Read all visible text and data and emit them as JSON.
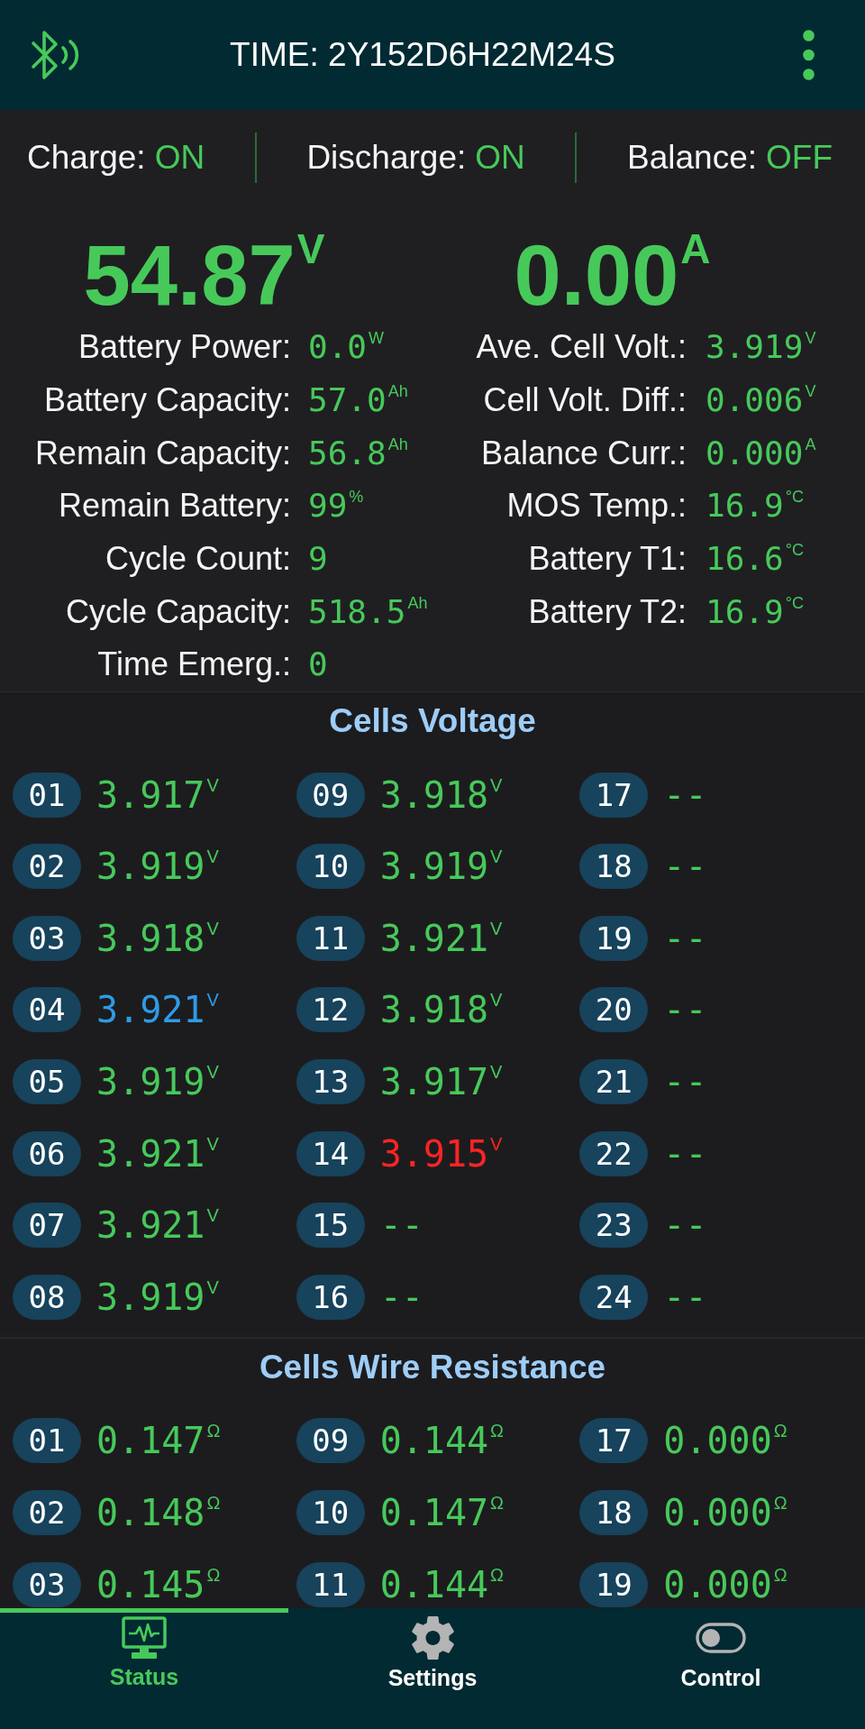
{
  "header": {
    "title": "TIME: 2Y152D6H22M24S"
  },
  "switches": [
    {
      "label": "Charge:",
      "value": "ON"
    },
    {
      "label": "Discharge:",
      "value": "ON"
    },
    {
      "label": "Balance:",
      "value": "OFF"
    }
  ],
  "readings": [
    {
      "value": "54.87$^{V}$"
    },
    {
      "value": "0.00$^{A}$"
    }
  ],
  "stat_columns": [
    {
      "rows": [
        {
          "label": "Battery Power:",
          "value": "0.0$^{W}$"
        },
        {
          "label": "Battery Capacity:",
          "value": "57.0$^{Ah}$"
        },
        {
          "label": "Remain Capacity:",
          "value": "56.8$^{Ah}$"
        },
        {
          "label": "Remain Battery:",
          "value": "99$^{%}$"
        },
        {
          "label": "Cycle Count:",
          "value": "9"
        },
        {
          "label": "Cycle Capacity:",
          "value": "518.5$^{Ah}$"
        },
        {
          "label": "Time Emerg.:",
          "value": "0"
        }
      ]
    },
    {
      "rows": [
        {
          "label": "Ave. Cell Volt.:",
          "value": "3.919$^{V}$"
        },
        {
          "label": "Cell Volt. Diff.:",
          "value": "0.006$^{V}$"
        },
        {
          "label": "Balance Curr.:",
          "value": "0.000$^{A}$"
        },
        {
          "label": "MOS Temp.:",
          "value": "16.9$^{°C}$"
        },
        {
          "label": "Battery T1:",
          "value": "16.6$^{°C}$"
        },
        {
          "label": "Battery T2:",
          "value": "16.9$^{°C}$"
        }
      ]
    }
  ],
  "panels": [
    {
      "title": "Cells Voltage",
      "columns": [
        {
          "cells": [
            {
              "number": "01",
              "value": "3.917$^{V}$",
              "color": "#47c95a"
            },
            {
              "number": "02",
              "value": "3.919$^{V}$",
              "color": "#47c95a"
            },
            {
              "number": "03",
              "value": "3.918$^{V}$",
              "color": "#47c95a"
            },
            {
              "number": "04",
              "value": "3.921$^{V}$",
              "color": "#2f9be6"
            },
            {
              "number": "05",
              "value": "3.919$^{V}$",
              "color": "#47c95a"
            },
            {
              "number": "06",
              "value": "3.921$^{V}$",
              "color": "#47c95a"
            },
            {
              "number": "07",
              "value": "3.921$^{V}$",
              "color": "#47c95a"
            },
            {
              "number": "08",
              "value": "3.919$^{V}$",
              "color": "#47c95a"
            }
          ]
        },
        {
          "cells": [
            {
              "number": "09",
              "value": "3.918$^{V}$",
              "color": "#47c95a"
            },
            {
              "number": "10",
              "value": "3.919$^{V}$",
              "color": "#47c95a"
            },
            {
              "number": "11",
              "value": "3.921$^{V}$",
              "color": "#47c95a"
            },
            {
              "number": "12",
              "value": "3.918$^{V}$",
              "color": "#47c95a"
            },
            {
              "number": "13",
              "value": "3.917$^{V}$",
              "color": "#47c95a"
            },
            {
              "number": "14",
              "value": "3.915$^{V}$",
              "color": "#ff2424"
            },
            {
              "number": "15",
              "value": "--",
              "color": "#47c95a"
            },
            {
              "number": "16",
              "value": "--",
              "color": "#47c95a"
            }
          ]
        },
        {
          "cells": [
            {
              "number": "17",
              "value": "--",
              "color": "#47c95a"
            },
            {
              "number": "18",
              "value": "--",
              "color": "#47c95a"
            },
            {
              "number": "19",
              "value": "--",
              "color": "#47c95a"
            },
            {
              "number": "20",
              "value": "--",
              "color": "#47c95a"
            },
            {
              "number": "21",
              "value": "--",
              "color": "#47c95a"
            },
            {
              "number": "22",
              "value": "--",
              "color": "#47c95a"
            },
            {
              "number": "23",
              "value": "--",
              "color": "#47c95a"
            },
            {
              "number": "24",
              "value": "--",
              "color": "#47c95a"
            }
          ]
        }
      ]
    },
    {
      "title": "Cells Wire Resistance",
      "columns": [
        {
          "cells": [
            {
              "number": "01",
              "value": "0.147$^{Ω}$",
              "color": "#47c95a"
            },
            {
              "number": "02",
              "value": "0.148$^{Ω}$",
              "color": "#47c95a"
            },
            {
              "number": "03",
              "value": "0.145$^{Ω}$",
              "color": "#47c95a"
            }
          ]
        },
        {
          "cells": [
            {
              "number": "09",
              "value": "0.144$^{Ω}$",
              "color": "#47c95a"
            },
            {
              "number": "10",
              "value": "0.147$^{Ω}$",
              "color": "#47c95a"
            },
            {
              "number": "11",
              "value": "0.144$^{Ω}$",
              "color": "#47c95a"
            }
          ]
        },
        {
          "cells": [
            {
              "number": "17",
              "value": "0.000$^{Ω}$",
              "color": "#47c95a"
            },
            {
              "number": "18",
              "value": "0.000$^{Ω}$",
              "color": "#47c95a"
            },
            {
              "number": "19",
              "value": "0.000$^{Ω}$",
              "color": "#47c95a"
            }
          ]
        }
      ]
    }
  ],
  "nav": [
    {
      "label": "Status",
      "selected": true
    },
    {
      "label": "Settings",
      "selected": false
    },
    {
      "label": "Control",
      "selected": false
    }
  ]
}
